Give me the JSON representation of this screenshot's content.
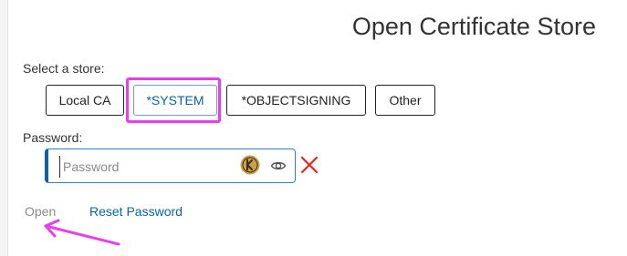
{
  "page": {
    "title": "Open Certificate Store"
  },
  "store_select": {
    "label": "Select a store:",
    "options": [
      "Local CA",
      "*SYSTEM",
      "*OBJECTSIGNING",
      "Other"
    ],
    "selected": "*SYSTEM"
  },
  "password": {
    "label": "Password:",
    "placeholder": "Password",
    "value": ""
  },
  "actions": {
    "open_label": "Open",
    "reset_label": "Reset Password"
  },
  "icons": {
    "password_manager": "keeper-icon",
    "reveal": "eye-icon",
    "clear": "close-icon"
  },
  "colors": {
    "accent": "#0a63a6",
    "highlight": "#e83ef0",
    "error": "#e2261c",
    "disabled_text": "#8a8a8a"
  }
}
